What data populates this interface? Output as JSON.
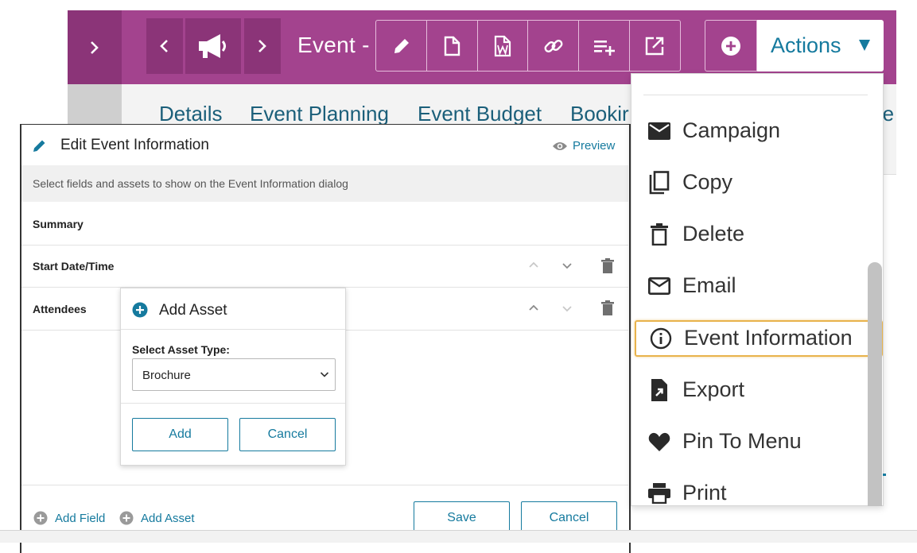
{
  "header": {
    "record_title": "Event - V",
    "toolbar_icons": [
      "pencil-icon",
      "document-icon",
      "word-icon",
      "link-icon",
      "playlist-add-icon",
      "open-external-icon"
    ],
    "actions_label": "Actions",
    "accent_color": "#a3438e"
  },
  "tabs": [
    "Details",
    "Event Planning",
    "Event Budget",
    "Bookir",
    "re"
  ],
  "dialog": {
    "title": "Edit Event Information",
    "preview_label": "Preview",
    "description": "Select fields and assets to show on the Event Information dialog",
    "fields": [
      "Summary",
      "Start Date/Time",
      "Attendees"
    ],
    "add_field_label": "Add Field",
    "add_asset_label": "Add Asset",
    "save_label": "Save",
    "cancel_label": "Cancel"
  },
  "add_asset": {
    "title": "Add Asset",
    "select_label": "Select Asset Type:",
    "selected_value": "Brochure",
    "add_label": "Add",
    "cancel_label": "Cancel"
  },
  "actions_menu": {
    "items": [
      {
        "label": "Campaign",
        "icon": "envelope-icon"
      },
      {
        "label": "Copy",
        "icon": "copy-icon"
      },
      {
        "label": "Delete",
        "icon": "trash-icon"
      },
      {
        "label": "Email",
        "icon": "mail-outline-icon"
      },
      {
        "label": "Event Information",
        "icon": "info-icon"
      },
      {
        "label": "Export",
        "icon": "export-icon"
      },
      {
        "label": "Pin To Menu",
        "icon": "heart-icon"
      },
      {
        "label": "Print",
        "icon": "printer-icon"
      }
    ],
    "highlighted_item": "Event Information",
    "highlight_color": "#e8b34c"
  },
  "colors": {
    "link": "#157a9e",
    "header": "#a3438e",
    "header_dark": "#8b3478"
  }
}
